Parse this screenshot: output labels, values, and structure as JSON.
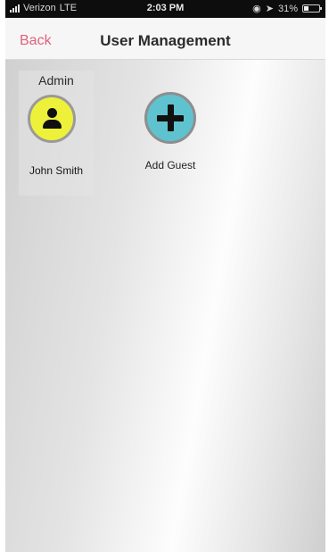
{
  "status_bar": {
    "carrier": "Verizon",
    "network": "LTE",
    "time": "2:03 PM",
    "battery": "31%",
    "battery_level": 0.31,
    "icons": [
      "signal-icon",
      "location-arrow-icon",
      "lock-rotation-icon",
      "battery-icon"
    ]
  },
  "nav": {
    "back_label": "Back",
    "title": "User Management"
  },
  "users": [
    {
      "role": "Admin",
      "name": "John Smith",
      "avatar_color": "#eef13a",
      "icon": "person-icon"
    }
  ],
  "add_guest": {
    "label": "Add Guest",
    "color": "#5fc2cf",
    "icon": "plus-icon"
  },
  "colors": {
    "accent": "#e0627a",
    "navbar": "#f6f6f6",
    "statusbar": "#0d0d0d"
  }
}
